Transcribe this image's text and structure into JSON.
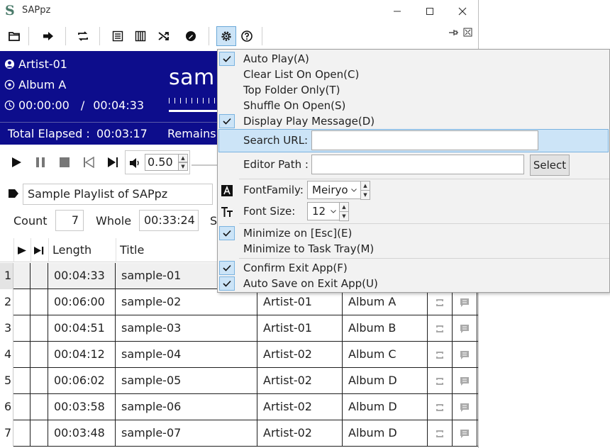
{
  "window": {
    "title": "SAPpz",
    "logo_letter": "S"
  },
  "header": {
    "artist": "Artist-01",
    "album": "Album A",
    "current_time": "00:00:00",
    "time_separator": "/",
    "total_time": "00:04:33",
    "now_playing_title": "sam",
    "total_elapsed_label": "Total Elapsed :",
    "total_elapsed_value": "00:03:17",
    "remains_label": "Remains"
  },
  "controls": {
    "volume": "0.50"
  },
  "playlist": {
    "name": "Sample Playlist of SAPpz",
    "count_label": "Count",
    "count_value": "7",
    "whole_label": "Whole",
    "whole_value": "00:33:24",
    "truncated_label": "S"
  },
  "table": {
    "headers": {
      "length": "Length",
      "title": "Title"
    },
    "rows": [
      {
        "index": "1",
        "length": "00:04:33",
        "title": "sample-01",
        "artist": "",
        "album": ""
      },
      {
        "index": "2",
        "length": "00:06:00",
        "title": "sample-02",
        "artist": "Artist-01",
        "album": "Album A"
      },
      {
        "index": "3",
        "length": "00:04:51",
        "title": "sample-03",
        "artist": "Artist-01",
        "album": "Album B"
      },
      {
        "index": "4",
        "length": "00:04:12",
        "title": "sample-04",
        "artist": "Artist-02",
        "album": "Album C"
      },
      {
        "index": "5",
        "length": "00:06:02",
        "title": "sample-05",
        "artist": "Artist-02",
        "album": "Album D"
      },
      {
        "index": "6",
        "length": "00:03:58",
        "title": "sample-06",
        "artist": "Artist-02",
        "album": "Album D"
      },
      {
        "index": "7",
        "length": "00:03:48",
        "title": "sample-07",
        "artist": "Artist-02",
        "album": "Album D"
      }
    ]
  },
  "settings_menu": {
    "auto_play": {
      "label": "Auto Play(A)",
      "checked": true
    },
    "clear_list": {
      "label": "Clear List On Open(C)",
      "checked": false
    },
    "top_folder": {
      "label": "Top Folder Only(T)",
      "checked": false
    },
    "shuffle": {
      "label": "Shuffle On Open(S)",
      "checked": false
    },
    "display_message": {
      "label": "Display Play Message(D)",
      "checked": true
    },
    "search_url_label": "Search URL:",
    "search_url_value": "",
    "editor_path_label": "Editor Path :",
    "editor_path_value": "",
    "select_button": "Select",
    "font_family_label": "FontFamily:",
    "font_family_value": "Meiryo",
    "font_size_label": "Font Size:",
    "font_size_value": "12",
    "minimize_esc": {
      "label": "Minimize on [Esc](E)",
      "checked": true
    },
    "minimize_tray": {
      "label": "Minimize to Task Tray(M)",
      "checked": false
    },
    "confirm_exit": {
      "label": "Confirm Exit App(F)",
      "checked": true
    },
    "auto_save": {
      "label": "Auto Save on Exit App(U)",
      "checked": true
    }
  },
  "colors": {
    "header_bg": "#0d0d8c",
    "check_bg": "#cce4f7",
    "highlight_row": "#cce4f7"
  }
}
